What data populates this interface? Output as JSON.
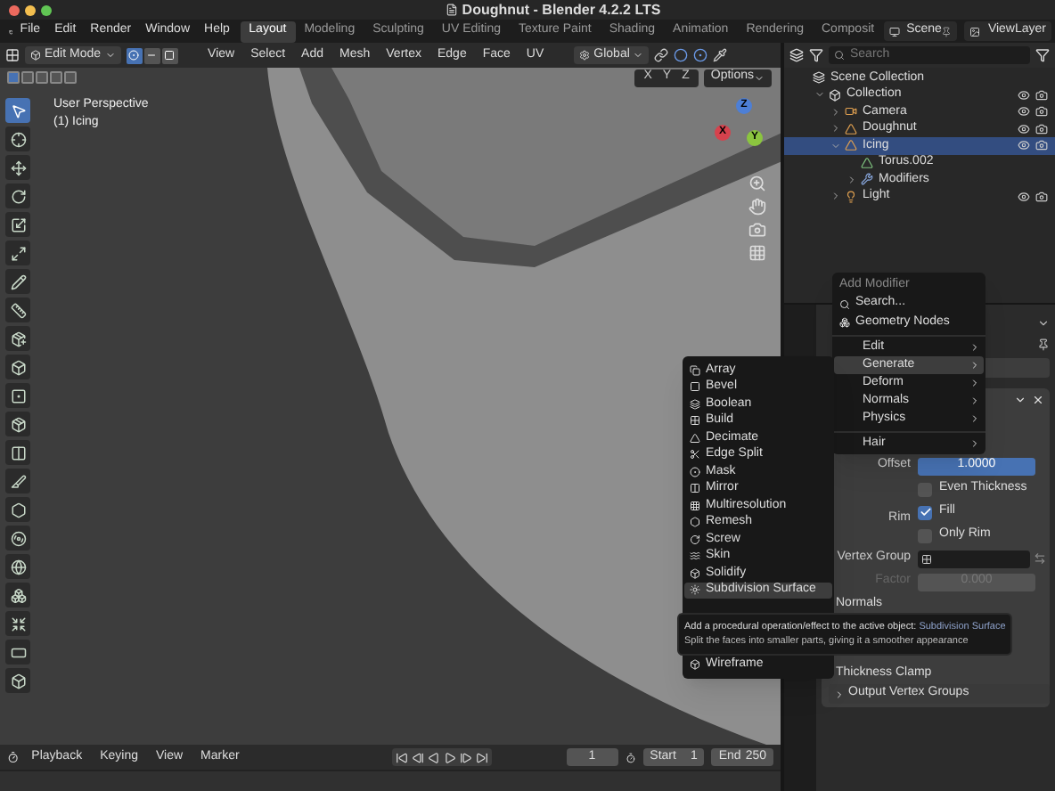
{
  "window": {
    "title": "Doughnut - Blender 4.2.2 LTS"
  },
  "menu": [
    "File",
    "Edit",
    "Render",
    "Window",
    "Help"
  ],
  "workspaces": [
    {
      "label": "Layout",
      "selected": true
    },
    {
      "label": "Modeling",
      "selected": false
    },
    {
      "label": "Sculpting",
      "selected": false
    },
    {
      "label": "UV Editing",
      "selected": false
    },
    {
      "label": "Texture Paint",
      "selected": false
    },
    {
      "label": "Shading",
      "selected": false
    },
    {
      "label": "Animation",
      "selected": false
    },
    {
      "label": "Rendering",
      "selected": false
    },
    {
      "label": "Composit",
      "selected": false
    }
  ],
  "scene": "Scene",
  "view_layer": "ViewLayer",
  "viewport_header": {
    "mode": "Edit Mode",
    "select_modes": [
      {
        "kind": "vertex",
        "selected": true
      },
      {
        "kind": "edge",
        "selected": false
      },
      {
        "kind": "face",
        "selected": false
      }
    ],
    "menus": [
      "View",
      "Select",
      "Add",
      "Mesh",
      "Vertex",
      "Edge",
      "Face",
      "UV"
    ],
    "orientation": "Global",
    "axes": [
      "X",
      "Y",
      "Z"
    ],
    "options": "Options"
  },
  "viewport": {
    "view_name": "User Perspective",
    "object": "(1) Icing",
    "gizmo": [
      {
        "label": "X",
        "color": "#d6424d"
      },
      {
        "label": "Y",
        "color": "#8bc53f"
      },
      {
        "label": "Z",
        "color": "#4d7fd6"
      }
    ]
  },
  "tools": [
    {
      "kind": "select",
      "selected": true
    },
    {
      "kind": "cursor",
      "selected": false
    },
    {
      "kind": "move",
      "selected": false
    },
    {
      "kind": "rotate",
      "selected": false
    },
    {
      "kind": "scale",
      "selected": false
    },
    {
      "kind": "transform",
      "selected": false
    },
    {
      "kind": "annotate",
      "selected": false
    },
    {
      "kind": "measure",
      "selected": false
    },
    {
      "kind": "add-cube",
      "selected": false
    },
    {
      "kind": "extrude",
      "selected": false
    },
    {
      "kind": "inset",
      "selected": false
    },
    {
      "kind": "bevel",
      "selected": false
    },
    {
      "kind": "loop-cut",
      "selected": false
    },
    {
      "kind": "knife",
      "selected": false
    },
    {
      "kind": "poly-build",
      "selected": false
    },
    {
      "kind": "spin",
      "selected": false
    },
    {
      "kind": "smooth",
      "selected": false
    },
    {
      "kind": "edge-slide",
      "selected": false
    },
    {
      "kind": "shrink",
      "selected": false
    },
    {
      "kind": "shear",
      "selected": false
    },
    {
      "kind": "rip",
      "selected": false
    }
  ],
  "outliner": {
    "search": {
      "placeholder": "Search"
    },
    "items": [
      {
        "kind": "scene",
        "label": "Scene Collection",
        "selected": false,
        "children": [
          {
            "kind": "collection",
            "label": "Collection",
            "selected": false,
            "expanded": true,
            "children": [
              {
                "kind": "camera",
                "label": "Camera",
                "selected": false,
                "expanded": false
              },
              {
                "kind": "mesh",
                "label": "Doughnut",
                "selected": false,
                "expanded": false
              },
              {
                "kind": "mesh",
                "label": "Icing",
                "selected": true,
                "expanded": true,
                "children": [
                  {
                    "kind": "mesh-data",
                    "label": "Torus.002",
                    "selected": false
                  },
                  {
                    "kind": "modifiers",
                    "label": "Modifiers",
                    "selected": false,
                    "expanded": false
                  }
                ]
              },
              {
                "kind": "light",
                "label": "Light",
                "selected": false,
                "expanded": false
              }
            ]
          }
        ]
      }
    ]
  },
  "modifier": {
    "rows": [
      {
        "kind": "value",
        "label": "Offset",
        "value": "1.0000",
        "level": 1
      },
      {
        "kind": "check",
        "label": "Even Thickness",
        "checked": false
      },
      {
        "kind": "check",
        "group": "Rim",
        "label": "Fill",
        "checked": true
      },
      {
        "kind": "check",
        "label": "Only Rim",
        "checked": false
      },
      {
        "kind": "vgroup",
        "label": "Vertex Group"
      },
      {
        "kind": "value",
        "label": "Factor",
        "value": "0.000",
        "disabled": true
      },
      {
        "kind": "header",
        "label": "Normals"
      },
      {
        "kind": "spacer"
      },
      {
        "kind": "header",
        "label": "Thickness Clamp"
      },
      {
        "kind": "subpanel",
        "label": "Output Vertex Groups"
      }
    ]
  },
  "add_menu": {
    "title": "Add Modifier",
    "search": "Search...",
    "items": [
      {
        "kind": "action",
        "label": "Geometry Nodes",
        "selected": false
      },
      {
        "kind": "separator"
      },
      {
        "kind": "submenu",
        "label": "Edit",
        "selected": false
      },
      {
        "kind": "submenu",
        "label": "Generate",
        "selected": true
      },
      {
        "kind": "submenu",
        "label": "Deform",
        "selected": false
      },
      {
        "kind": "submenu",
        "label": "Normals",
        "selected": false
      },
      {
        "kind": "submenu",
        "label": "Physics",
        "selected": false
      },
      {
        "kind": "separator"
      },
      {
        "kind": "submenu",
        "label": "Hair",
        "selected": false
      }
    ]
  },
  "generate_menu": [
    {
      "kind": "array",
      "label": "Array",
      "selected": false
    },
    {
      "kind": "bevel",
      "label": "Bevel",
      "selected": false
    },
    {
      "kind": "boolean",
      "label": "Boolean",
      "selected": false
    },
    {
      "kind": "build",
      "label": "Build",
      "selected": false
    },
    {
      "kind": "decimate",
      "label": "Decimate",
      "selected": false
    },
    {
      "kind": "edge-split",
      "label": "Edge Split",
      "selected": false
    },
    {
      "kind": "mask",
      "label": "Mask",
      "selected": false
    },
    {
      "kind": "mirror",
      "label": "Mirror",
      "selected": false
    },
    {
      "kind": "multires",
      "label": "Multiresolution",
      "selected": false
    },
    {
      "kind": "remesh",
      "label": "Remesh",
      "selected": false
    },
    {
      "kind": "screw",
      "label": "Screw",
      "selected": false
    },
    {
      "kind": "skin",
      "label": "Skin",
      "selected": false
    },
    {
      "kind": "solidify",
      "label": "Solidify",
      "selected": false
    },
    {
      "kind": "subsurf",
      "label": "Subdivision Surface",
      "selected": true
    },
    {
      "kind": "gap"
    },
    {
      "kind": "wireframe",
      "label": "Wireframe",
      "selected": false
    }
  ],
  "tooltip": {
    "text": "Add a procedural operation/effect to the active object:",
    "target": "Subdivision Surface",
    "description": "Split the faces into smaller parts, giving it a smoother appearance"
  },
  "timeline": {
    "menus": [
      "Playback",
      "Keying",
      "View",
      "Marker"
    ],
    "frame": "1",
    "start_label": "Start",
    "start": "1",
    "end_label": "End",
    "end": "250"
  }
}
